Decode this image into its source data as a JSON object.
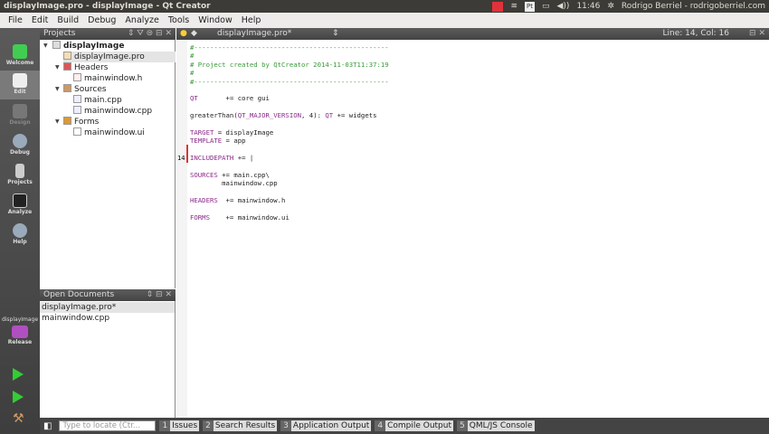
{
  "window": {
    "title": "displayImage.pro - displayImage - Qt Creator"
  },
  "tray": {
    "pt": "Pt",
    "time": "11:46",
    "user": "Rodrigo Berriel - rodrigoberriel.com"
  },
  "menu": [
    "File",
    "Edit",
    "Build",
    "Debug",
    "Analyze",
    "Tools",
    "Window",
    "Help"
  ],
  "modes": [
    "Welcome",
    "Edit",
    "Design",
    "Debug",
    "Projects",
    "Analyze",
    "Help"
  ],
  "kit": {
    "project": "displayImage",
    "config": "Release"
  },
  "projects": {
    "title": "Projects",
    "root": "displayImage",
    "pro": "displayImage.pro",
    "headers": "Headers",
    "h1": "mainwindow.h",
    "sources": "Sources",
    "s1": "main.cpp",
    "s2": "mainwindow.cpp",
    "forms": "Forms",
    "f1": "mainwindow.ui"
  },
  "opendocs": {
    "title": "Open Documents",
    "items": [
      "displayImage.pro*",
      "mainwindow.cpp"
    ]
  },
  "editor": {
    "file": "displayImage.pro*",
    "position": "Line: 14, Col: 16",
    "current_line": "14"
  },
  "code": {
    "l1": "#-------------------------------------------------",
    "l2": "#",
    "l3": "# Project created by QtCreator 2014-11-03T11:37:19",
    "l4": "#",
    "l5": "#-------------------------------------------------",
    "l7a": "QT",
    "l7b": "       += core gui",
    "l9a": "greaterThan(",
    "l9b": "QT_MAJOR_VERSION",
    "l9c": ", 4): ",
    "l9d": "QT",
    "l9e": " += widgets",
    "l11a": "TARGET",
    "l11b": " = displayImage",
    "l12a": "TEMPLATE",
    "l12b": " = app",
    "l14a": "INCLUDEPATH",
    "l14b": " += |",
    "l16a": "SOURCES",
    "l16b": " += main.cpp\\",
    "l17": "        mainwindow.cpp",
    "l19a": "HEADERS",
    "l19b": "  += mainwindow.h",
    "l21a": "FORMS",
    "l21b": "    += mainwindow.ui"
  },
  "statusbar": {
    "locate_placeholder": "Type to locate (Ctr...",
    "tabs": [
      {
        "n": "1",
        "l": "Issues"
      },
      {
        "n": "2",
        "l": "Search Results"
      },
      {
        "n": "3",
        "l": "Application Output"
      },
      {
        "n": "4",
        "l": "Compile Output"
      },
      {
        "n": "5",
        "l": "QML/JS Console"
      }
    ]
  }
}
